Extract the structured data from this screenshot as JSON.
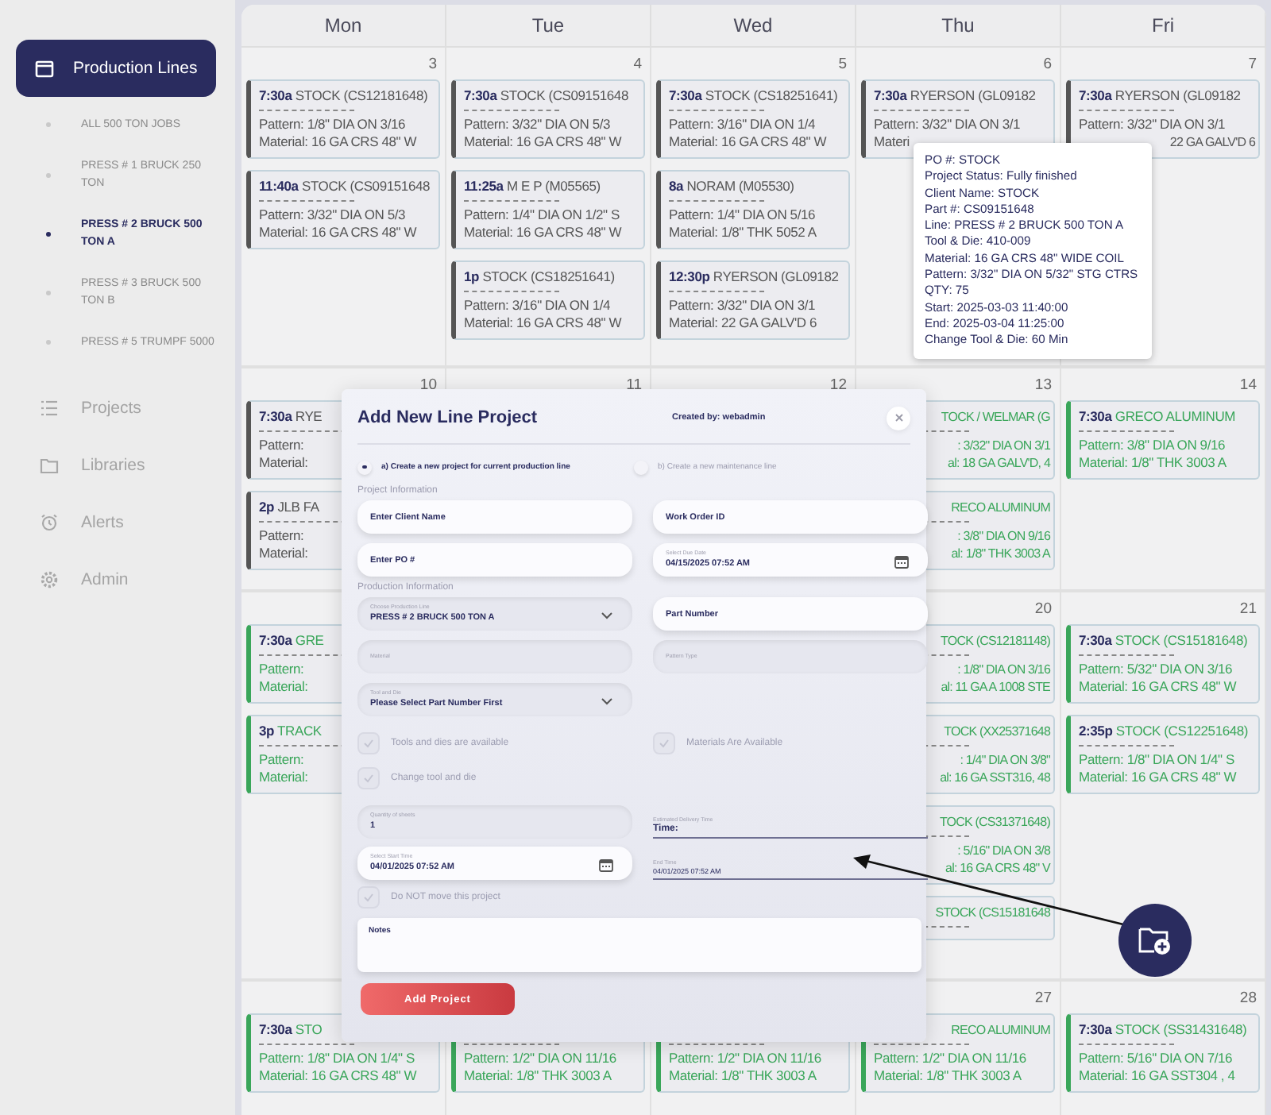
{
  "sidebar": {
    "primary": {
      "label": "Production Lines",
      "selected": true
    },
    "lines": [
      {
        "label": "ALL 500 TON JOBS",
        "selected": false
      },
      {
        "label": "PRESS # 1 BRUCK 250 TON",
        "selected": false
      },
      {
        "label": "PRESS # 2 BRUCK 500 TON A",
        "selected": true
      },
      {
        "label": "PRESS # 3 BRUCK 500 TON B",
        "selected": false
      },
      {
        "label": "PRESS # 5 TRUMPF 5000",
        "selected": false
      }
    ],
    "nav": [
      "Projects",
      "Libraries",
      "Alerts",
      "Admin"
    ]
  },
  "calendar": {
    "weekdays": [
      "Mon",
      "Tue",
      "Wed",
      "Thu",
      "Fri"
    ],
    "weeks": [
      {
        "days": [
          {
            "number": "3",
            "events": [
              {
                "time": "7:30a",
                "title": "STOCK (CS12181648)",
                "pattern": "Pattern: 1/8\" DIA ON 3/16",
                "material": "Material: 16 GA CRS 48\" W",
                "color": "#555555"
              },
              {
                "time": "11:40a",
                "title": "STOCK (CS09151648",
                "pattern": "Pattern: 3/32\" DIA ON 5/3",
                "material": "Material: 16 GA CRS 48\" W",
                "color": "#555555"
              }
            ]
          },
          {
            "number": "4",
            "events": [
              {
                "time": "7:30a",
                "title": "STOCK (CS09151648",
                "pattern": "Pattern: 3/32\" DIA ON 5/3",
                "material": "Material: 16 GA CRS 48\" W",
                "color": "#555555"
              },
              {
                "time": "11:25a",
                "title": "M E P (M05565)",
                "pattern": "Pattern: 1/4\" DIA ON 1/2\" S",
                "material": "Material: 16 GA CRS 48\" W",
                "color": "#555555"
              },
              {
                "time": "1p",
                "title": "STOCK (CS18251641)",
                "pattern": "Pattern: 3/16\" DIA ON 1/4",
                "material": "Material: 16 GA CRS 48\" W",
                "color": "#555555"
              }
            ]
          },
          {
            "number": "5",
            "events": [
              {
                "time": "7:30a",
                "title": "STOCK (CS18251641)",
                "pattern": "Pattern: 3/16\" DIA ON 1/4",
                "material": "Material: 16 GA CRS 48\" W",
                "color": "#555555"
              },
              {
                "time": "8a",
                "title": "NORAM (M05530)",
                "pattern": "Pattern: 1/4\" DIA ON 5/16",
                "material": "Material: 1/8\" THK 5052 A",
                "color": "#555555"
              },
              {
                "time": "12:30p",
                "title": "RYERSON (GL09182",
                "pattern": "Pattern: 3/32\" DIA ON 3/1",
                "material": "Material: 22 GA GALV'D 6",
                "color": "#555555"
              }
            ]
          },
          {
            "number": "6",
            "events": [
              {
                "time": "7:30a",
                "title": "RYERSON (GL09182",
                "pattern": "Pattern: 3/32\" DIA ON 3/1",
                "material": "Materi",
                "color": "#555555"
              }
            ]
          },
          {
            "number": "7",
            "events": [
              {
                "time": "7:30a",
                "title": "RYERSON (GL09182",
                "pattern": "Pattern: 3/32\" DIA ON 3/1",
                "material": "22 GA GALV'D 6",
                "color": "#555555"
              }
            ]
          }
        ]
      },
      {
        "days": [
          {
            "number": "10",
            "events": [
              {
                "time": "7:30a",
                "title": "RYE",
                "pattern": "Pattern:",
                "material": "Material:",
                "color": "#555555"
              },
              {
                "time": "2p",
                "title": "JLB FA",
                "pattern": "Pattern:",
                "material": "Material:",
                "color": "#555555"
              }
            ]
          },
          {
            "number": "11"
          },
          {
            "number": "12"
          },
          {
            "number": "13",
            "events": [
              {
                "title": "TOCK / WELMAR (G",
                "pattern": ": 3/32\" DIA ON 3/1",
                "material": "al: 18 GA GALV'D, 4",
                "color": "#3aa65a"
              },
              {
                "title": "RECO ALUMINUM",
                "pattern": ": 3/8\" DIA ON 9/16",
                "material": "al: 1/8\" THK 3003 A",
                "color": "#3aa65a"
              }
            ]
          },
          {
            "number": "14",
            "events": [
              {
                "time": "7:30a",
                "title": "GRECO ALUMINUM",
                "pattern": "Pattern: 3/8\" DIA ON 9/16",
                "material": "Material: 1/8\" THK 3003 A",
                "color": "#3aa65a"
              }
            ]
          }
        ]
      },
      {
        "days": {
          "mon": {
            "events": [
              {
                "time": "7:30a",
                "title": "GRE",
                "pattern": "Pattern:",
                "material": "Material:",
                "color": "#3aa65a"
              },
              {
                "time": "3p",
                "title": "TRACK",
                "pattern": "Pattern:",
                "material": "Material:",
                "color": "#3aa65a"
              }
            ]
          },
          "thu": {
            "number": "20",
            "events": [
              {
                "title": "TOCK (CS12181148)",
                "pattern": ": 1/8\" DIA ON 3/16",
                "material": "al: 11 GA A 1008 STE",
                "color": "#3aa65a"
              },
              {
                "title": "TOCK (XX25371648",
                "pattern": ": 1/4\" DIA ON 3/8\"",
                "material": "al: 16 GA SST316, 48",
                "color": "#3aa65a"
              },
              {
                "title": "TOCK (CS31371648)",
                "pattern": ": 5/16\" DIA ON 3/8",
                "material": "al: 16 GA CRS 48\" V",
                "color": "#3aa65a"
              },
              {
                "title": "STOCK (CS15181648",
                "color": "#3aa65a"
              }
            ]
          },
          "fri": {
            "number": "21",
            "events": [
              {
                "time": "7:30a",
                "title": "STOCK (CS15181648)",
                "pattern": "Pattern: 5/32\" DIA ON 3/16",
                "material": "Material: 16 GA CRS 48\" W",
                "color": "#3aa65a"
              },
              {
                "time": "2:35p",
                "title": "STOCK (CS12251648)",
                "pattern": "Pattern: 1/8\" DIA ON 1/4\" S",
                "material": "Material: 16 GA CRS 48\" W",
                "color": "#3aa65a"
              }
            ]
          }
        }
      },
      {
        "days": [
          {
            "events": [
              {
                "time": "7:30a",
                "title": "STO",
                "pattern": "Pattern: 1/8\" DIA ON 1/4\" S",
                "material": "Material: 16 GA CRS 48\" W",
                "color": "#3aa65a"
              }
            ]
          },
          {
            "events": [
              {
                "pattern": "Pattern: 1/2\" DIA ON 11/16",
                "material": "Material: 1/8\" THK 3003 A",
                "color": "#3aa65a"
              }
            ]
          },
          {
            "events": [
              {
                "pattern": "Pattern: 1/2\" DIA ON 11/16",
                "material": "Material: 1/8\" THK 3003 A",
                "color": "#3aa65a"
              }
            ]
          },
          {
            "number": "27",
            "events": [
              {
                "title": "RECO ALUMINUM",
                "pattern": "Pattern: 1/2\" DIA ON 11/16",
                "material": "Material: 1/8\" THK 3003 A",
                "color": "#3aa65a"
              }
            ]
          },
          {
            "number": "28",
            "events": [
              {
                "time": "7:30a",
                "title": "STOCK (SS31431648)",
                "pattern": "Pattern: 5/16\" DIA ON 7/16",
                "material": "Material: 16 GA SST304 , 4",
                "color": "#3aa65a"
              }
            ]
          }
        ]
      }
    ]
  },
  "tooltip": {
    "lines": [
      "PO #: STOCK",
      "Project Status: Fully finished",
      "Client Name: STOCK",
      "Part #: CS09151648",
      "Line: PRESS # 2 BRUCK 500 TON A",
      "Tool & Die: 410-009",
      "Material: 16 GA CRS 48\" WIDE COIL",
      "Pattern: 3/32\" DIA ON 5/32\" STG CTRS",
      "QTY: 75",
      "Start: 2025-03-03 11:40:00",
      "End: 2025-03-04 11:25:00",
      "Change Tool & Die: 60 Min"
    ]
  },
  "modal": {
    "title": "Add New Line Project",
    "created_by": "Created by: webadmin",
    "options": [
      {
        "label": "a) Create a new project for current production line",
        "selected": true
      },
      {
        "label": "b) Create a new maintenance line",
        "selected": false
      }
    ],
    "project_heading": "Project Information",
    "client_name": {
      "placeholder": "Enter Client Name"
    },
    "work_order": {
      "placeholder": "Work Order ID"
    },
    "po": {
      "placeholder": "Enter PO #"
    },
    "due_date": {
      "label": "Select Due Date",
      "value": "04/15/2025 07:52 AM"
    },
    "production_heading": "Production Information",
    "production_line": {
      "label": "Choose Production Line",
      "value": "PRESS # 2 BRUCK 500 TON A"
    },
    "part_number": {
      "placeholder": "Part Number"
    },
    "material": {
      "label": "Material",
      "disabled": true
    },
    "pattern_type": {
      "label": "Pattern Type",
      "disabled": true
    },
    "tool_die": {
      "label": "Tool and Die",
      "value": "Please Select Part Number First"
    },
    "checks": [
      {
        "label": "Tools and dies are available",
        "checked": false,
        "disabled": true
      },
      {
        "label": "Materials Are Available",
        "checked": false,
        "disabled": true
      },
      {
        "label": "Change tool and die",
        "checked": false,
        "disabled": true
      }
    ],
    "quantity": {
      "label": "Quantity of sheets",
      "value": "1",
      "disabled": true
    },
    "delivery": {
      "label": "Estimated Delivery Time",
      "value": "Time:"
    },
    "start": {
      "label": "Select Start Time",
      "value": "04/01/2025 07:52 AM"
    },
    "end": {
      "label": "End Time",
      "value": "04/01/2025 07:52 AM"
    },
    "no_move": {
      "label": "Do NOT move this project",
      "checked": false,
      "disabled": true
    },
    "notes": {
      "placeholder": "Notes"
    },
    "submit": "Add Project"
  }
}
